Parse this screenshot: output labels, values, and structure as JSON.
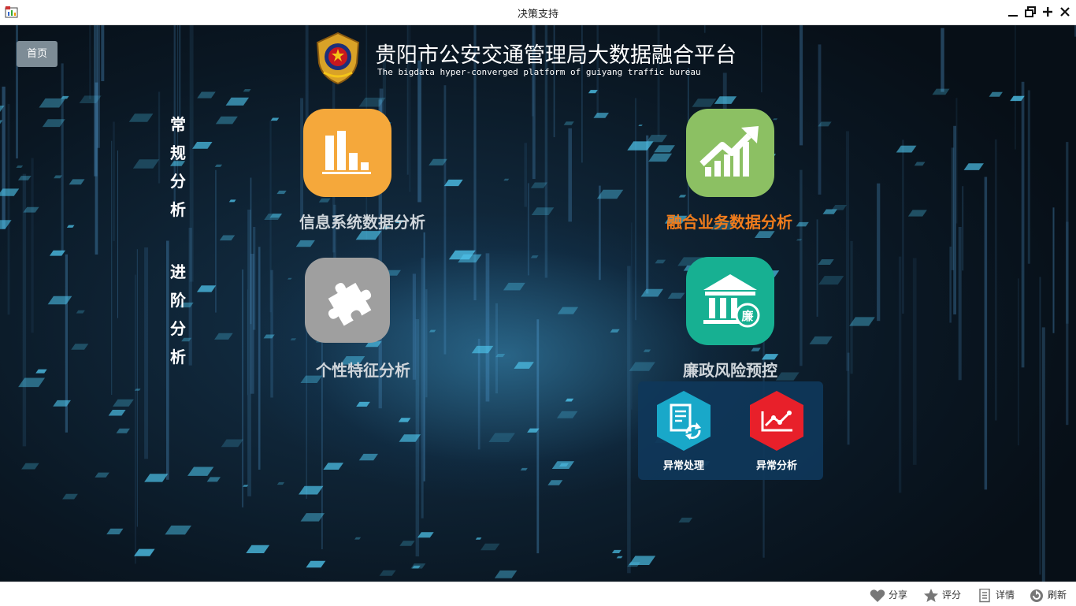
{
  "window": {
    "title": "决策支持"
  },
  "nav": {
    "home_label": "首页"
  },
  "header": {
    "title_cn": "贵阳市公安交通管理局大数据融合平台",
    "title_en": "The bigdata hyper-converged platform of guiyang traffic bureau"
  },
  "side_menu": [
    {
      "chars": [
        "常",
        "规",
        "分",
        "析"
      ]
    },
    {
      "chars": [
        "进",
        "阶",
        "分",
        "析"
      ]
    }
  ],
  "tiles": {
    "info_system": {
      "label": "信息系统数据分析",
      "color": "#f5a83b",
      "icon": "bar-chart-icon"
    },
    "fusion": {
      "label": "融合业务数据分析",
      "color": "#8cc063",
      "label_color": "#f07c1c",
      "icon": "trend-up-icon"
    },
    "personal": {
      "label": "个性特征分析",
      "color": "#9f9f9f",
      "icon": "puzzle-icon"
    },
    "integrity": {
      "label": "廉政风险预控",
      "color": "#17b092",
      "icon": "bank-icon",
      "badge": "廉"
    }
  },
  "sub_menu": {
    "anomaly_handling": {
      "label": "异常处理",
      "color": "#19a8c9",
      "icon": "document-refresh-icon"
    },
    "anomaly_analysis": {
      "label": "异常分析",
      "color": "#e8202a",
      "icon": "line-chart-icon"
    }
  },
  "toolbar": {
    "share": "分享",
    "rate": "评分",
    "details": "详情",
    "refresh": "刷新"
  }
}
